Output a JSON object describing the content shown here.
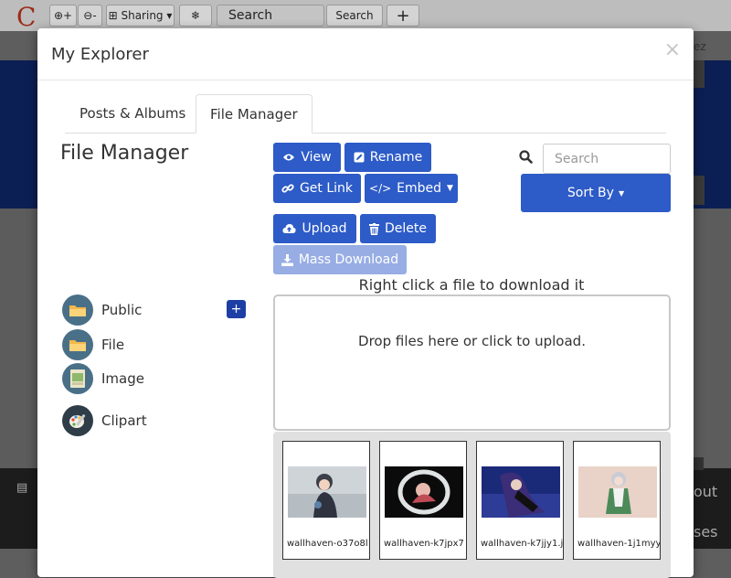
{
  "background_app": {
    "toolbar": {
      "zoom_in_label": "+",
      "zoom_out_label": "-",
      "sharing_label": "Sharing",
      "search_value": "Search",
      "search_button": "Search"
    },
    "right_edge_texts": [
      "ez",
      "out",
      "ses"
    ]
  },
  "modal": {
    "title": "My Explorer",
    "close_symbol": "×",
    "tabs": [
      {
        "label": "Posts & Albums",
        "active": false
      },
      {
        "label": "File Manager",
        "active": true
      }
    ],
    "section_title": "File Manager",
    "buttons": {
      "view": "View",
      "rename": "Rename",
      "get_link": "Get Link",
      "embed": "Embed",
      "upload": "Upload",
      "delete": "Delete",
      "mass_download": "Mass Download"
    },
    "search": {
      "placeholder": "Search"
    },
    "sort_by": "Sort By",
    "hint": "Right click a file to download it",
    "dropzone_text": "Drop files here or click to upload.",
    "folders": [
      {
        "label": "Public",
        "icon": "folder-icon"
      },
      {
        "label": "File",
        "icon": "folder-icon"
      },
      {
        "label": "Image",
        "icon": "image-file-icon"
      },
      {
        "label": "Clipart",
        "icon": "palette-icon"
      }
    ],
    "add_folder_symbol": "+",
    "files": [
      {
        "name": "wallhaven-o37o8l"
      },
      {
        "name": "wallhaven-k7jpx7"
      },
      {
        "name": "wallhaven-k7jjy1.j"
      },
      {
        "name": "wallhaven-1j1myy"
      }
    ],
    "colors": {
      "primary": "#2d5bc7",
      "primary_disabled": "#97ade4",
      "navy": "#1d3fa5"
    }
  }
}
